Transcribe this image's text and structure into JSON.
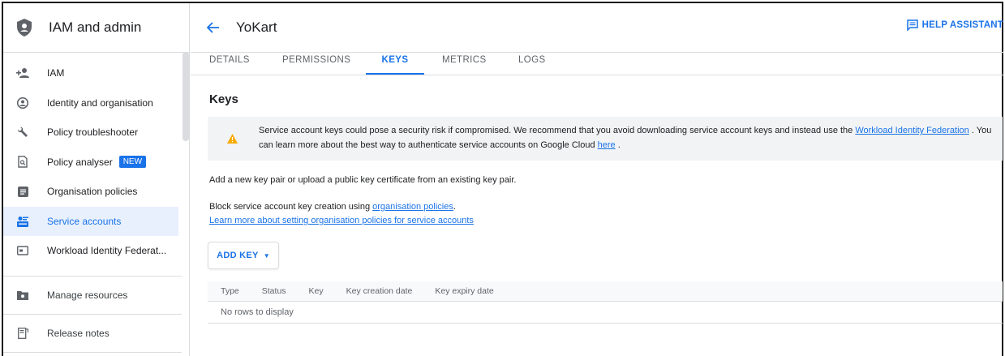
{
  "sidebar": {
    "title": "IAM and admin",
    "items": [
      {
        "label": "IAM",
        "icon": "person-add-icon"
      },
      {
        "label": "Identity and organisation",
        "icon": "account-circle-icon"
      },
      {
        "label": "Policy troubleshooter",
        "icon": "wrench-icon"
      },
      {
        "label": "Policy analyser",
        "icon": "document-search-icon",
        "badge": "NEW"
      },
      {
        "label": "Organisation policies",
        "icon": "list-box-icon"
      },
      {
        "label": "Service accounts",
        "icon": "service-account-icon",
        "active": true
      },
      {
        "label": "Workload Identity Federat...",
        "icon": "id-card-icon"
      }
    ],
    "lower_items": [
      {
        "label": "Manage resources",
        "icon": "folder-settings-icon"
      },
      {
        "label": "Release notes",
        "icon": "release-notes-icon"
      }
    ]
  },
  "header": {
    "title": "YoKart",
    "help_label": "HELP ASSISTANT"
  },
  "tabs": [
    {
      "label": "DETAILS"
    },
    {
      "label": "PERMISSIONS"
    },
    {
      "label": "KEYS",
      "active": true
    },
    {
      "label": "METRICS"
    },
    {
      "label": "LOGS"
    }
  ],
  "main": {
    "heading": "Keys",
    "alert": {
      "text1": "Service account keys could pose a security risk if compromised. We recommend that you avoid downloading service account keys and instead use the ",
      "link1": "Workload Identity Federation",
      "text2": " . You can learn more about the best way to authenticate service accounts on Google Cloud ",
      "link2": "here",
      "text3": " ."
    },
    "add_pair_text": "Add a new key pair or upload a public key certificate from an existing key pair.",
    "block_text": "Block service account key creation using ",
    "block_link": "organisation policies",
    "block_end": ".",
    "learn_more_link": "Learn more about setting organisation policies for service accounts",
    "add_key_label": "ADD KEY",
    "table": {
      "columns": [
        "Type",
        "Status",
        "Key",
        "Key creation date",
        "Key expiry date"
      ],
      "empty_text": "No rows to display"
    }
  },
  "colors": {
    "accent": "#1a73e8",
    "warning": "#f9ab00",
    "active_bg": "#e8f0fe"
  }
}
